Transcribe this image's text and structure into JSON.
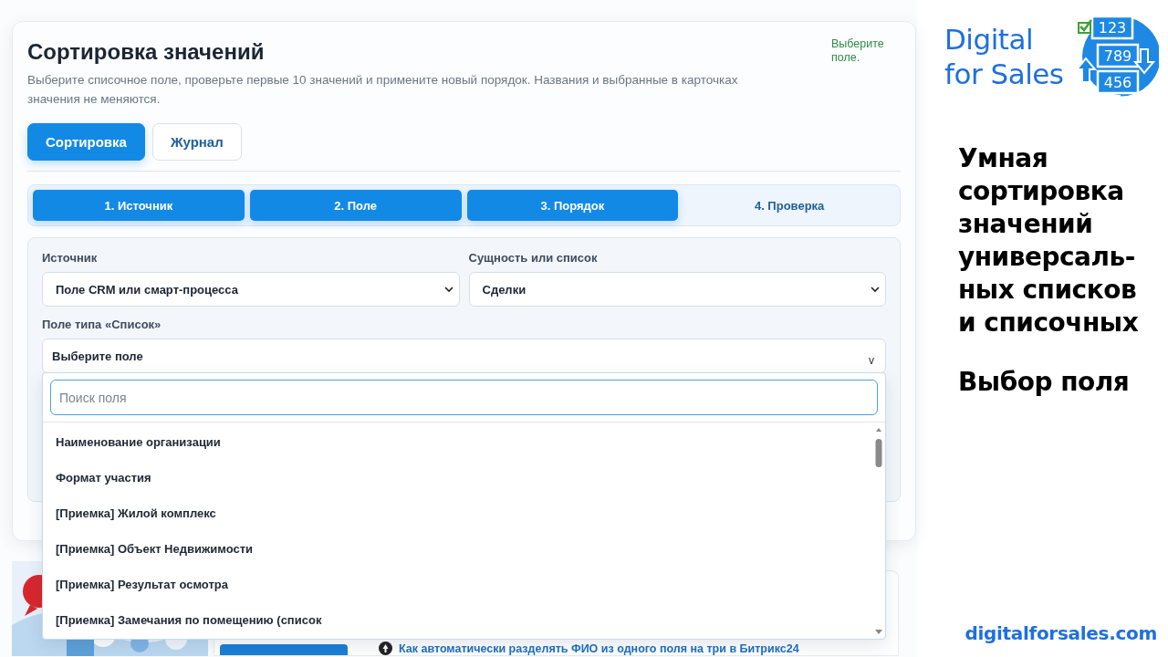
{
  "card": {
    "title": "Сортировка значений",
    "subtitle": "Выберите списочное поле, проверьте первые 10 значений и примените новый порядок. Названия и выбранные в карточках значения не меняются.",
    "status": "Выберите поле.",
    "tabs": [
      {
        "label": "Сортировка",
        "selected": true
      },
      {
        "label": "Журнал",
        "selected": false
      }
    ],
    "steps": [
      {
        "label": "1. Источник",
        "completed": true
      },
      {
        "label": "2. Поле",
        "completed": true
      },
      {
        "label": "3. Порядок",
        "completed": true
      },
      {
        "label": "4. Проверка",
        "completed": false
      }
    ],
    "form": {
      "source": {
        "label": "Источник",
        "value": "Поле CRM или смарт-процесса"
      },
      "entity": {
        "label": "Сущность или список",
        "value": "Сделки"
      },
      "field": {
        "label": "Поле типа «Список»",
        "value": "Выберите поле",
        "caret": "v"
      }
    },
    "dropdown": {
      "search_placeholder": "Поиск поля",
      "items": [
        "Наименование организации",
        "Формат участия",
        "[Приемка] Жилой комплекс",
        "[Приемка] Объект Недвижимости",
        "[Приемка] Результат осмотра",
        "[Приемка] Замечания по помещению (список"
      ]
    }
  },
  "background_page": {
    "link": "Как автоматически разделять ФИО из одного поля на три в Битрикс24"
  },
  "brand": {
    "name_lines": [
      "Digital",
      "for Sales"
    ],
    "logo_numbers": [
      "123",
      "789",
      "456"
    ],
    "headline": "Умная\nсортировка\nзначений\nуниверсаль-\nных списков\nи списочных",
    "subheading": "Выбор поля",
    "url": "digitalforsales.com"
  }
}
